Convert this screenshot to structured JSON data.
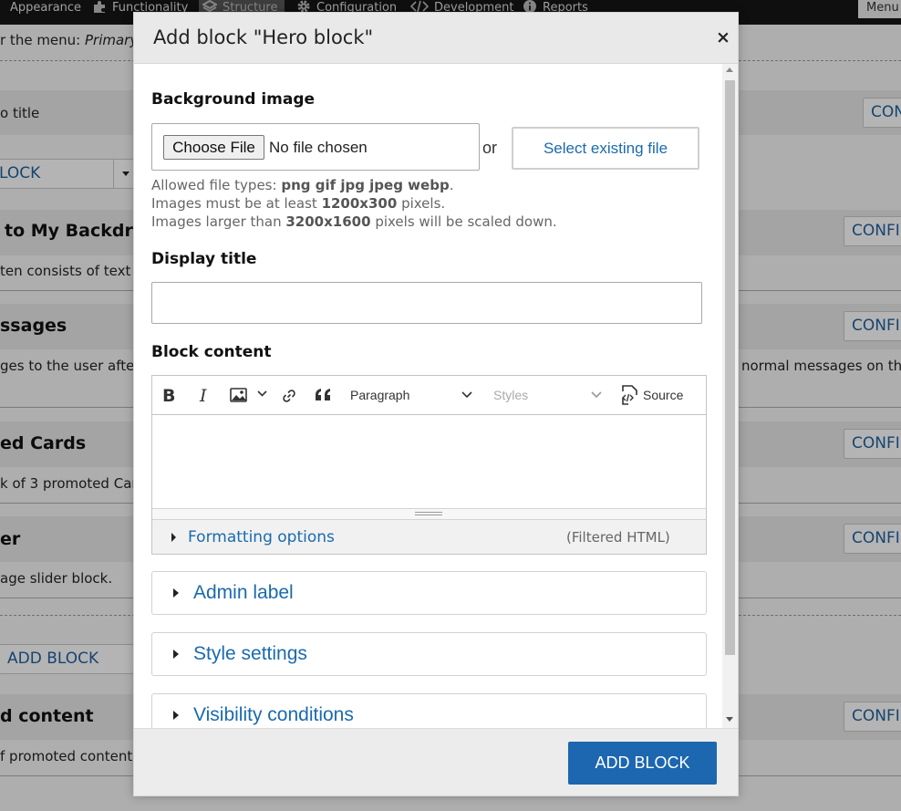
{
  "toolbar": {
    "items": [
      "Appearance",
      "Functionality",
      "Structure",
      "Configuration",
      "Development",
      "Reports"
    ],
    "menu_label": "Menu"
  },
  "background": {
    "menu_line_prefix": "r the menu: ",
    "menu_line_name": "Primary",
    "rows": [
      {
        "title": "o title",
        "button": "CON"
      },
      {
        "title": "LOCK",
        "kind": "link"
      },
      {
        "title": "to My Backdro",
        "desc": "ten consists of text c",
        "button": "CONFI"
      },
      {
        "title": "ssages",
        "desc": "ges to the user after",
        "desc_right": "normal messages on the",
        "button": "CONFI"
      },
      {
        "title": "ed Cards",
        "desc": "k of 3 promoted Card",
        "button": "CONFI"
      },
      {
        "title": "er",
        "desc": "age slider block.",
        "button": "CONFI"
      },
      {
        "title": "ADD BLOCK",
        "kind": "link"
      },
      {
        "title": "d content",
        "desc": "f promoted content",
        "button": "CONFI"
      }
    ]
  },
  "modal": {
    "title": "Add block \"Hero block\"",
    "close_symbol": "×",
    "background_image": {
      "label": "Background image",
      "choose_file_label": "Choose File",
      "no_file_text": "No file chosen",
      "or_text": "or",
      "select_existing_label": "Select existing file",
      "help_allowed_prefix": "Allowed file types: ",
      "help_allowed_types": "png gif jpg jpeg webp",
      "help_allowed_suffix": ".",
      "help_min_prefix": "Images must be at least ",
      "help_min_size": "1200x300",
      "help_min_suffix": " pixels.",
      "help_max_prefix": "Images larger than ",
      "help_max_size": "3200x1600",
      "help_max_suffix": " pixels will be scaled down."
    },
    "display_title": {
      "label": "Display title",
      "value": ""
    },
    "block_content": {
      "label": "Block content",
      "toolbar": {
        "bold_glyph": "B",
        "italic_glyph": "I",
        "paragraph": "Paragraph",
        "styles": "Styles",
        "source": "Source"
      },
      "formatting_options": "Formatting options",
      "text_format": "(Filtered HTML)"
    },
    "sections": [
      "Admin label",
      "Style settings",
      "Visibility conditions"
    ],
    "submit_label": "ADD BLOCK"
  }
}
